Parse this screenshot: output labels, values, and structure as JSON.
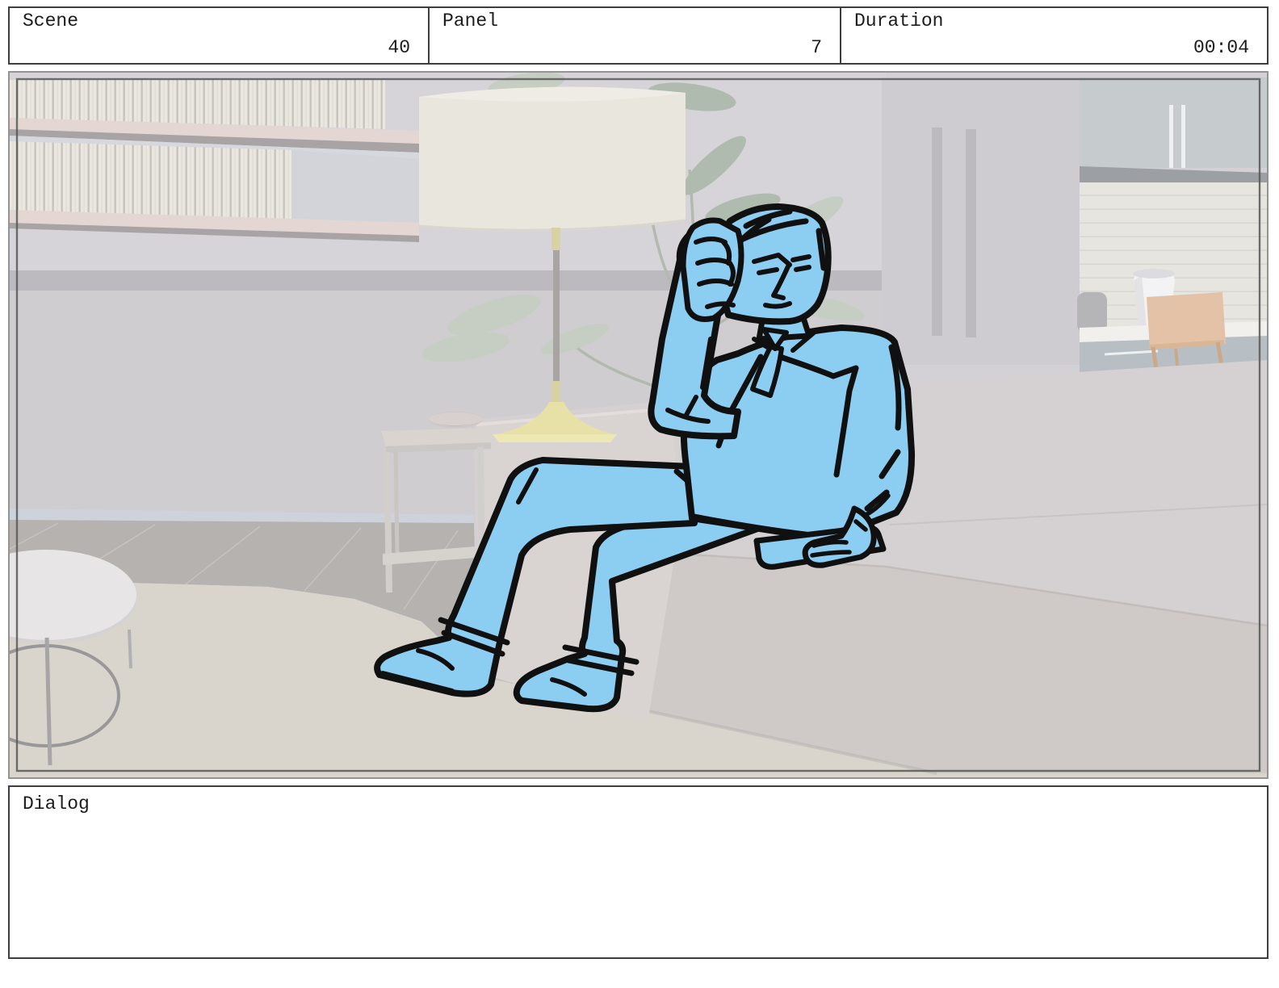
{
  "header": {
    "cells": [
      {
        "label": "Scene",
        "value": "40"
      },
      {
        "label": "Panel",
        "value": "7"
      },
      {
        "label": "Duration",
        "value": "00:04"
      }
    ]
  },
  "dialog": {
    "label": "Dialog",
    "content": ""
  },
  "storyboard": {
    "panel_description": "Sketched man in a suit sits on a sofa, elbow on knee, hand to temple, frowning, holding a remote; living-room background with bookshelf, drum lamp, plant, side table, round coffee table and kitchen.",
    "colors": {
      "character_blue": "#8ccdf2",
      "outline": "#101010",
      "wall": "#d3d1d6",
      "band": "#bdbabf",
      "shelf": "#e4d7d3",
      "couch": "#d5d0d1",
      "couch_front": "#cfcac7",
      "armrest": "#d9d4d2",
      "floor_dark": "#b6b2af",
      "rug": "#d9d5cd",
      "lamp_shade": "#e9e6de",
      "lamp_base": "#e7e1a8",
      "leaf": "#c6cdc3",
      "leaf_dark": "#aebbae",
      "table": "#d9d4d0",
      "partition": "#cfccd1",
      "cabinet": "#c6cbce",
      "strip": "#9ca0a4",
      "chair": "#e3c2a7",
      "counter": "#f2f0ec"
    }
  }
}
